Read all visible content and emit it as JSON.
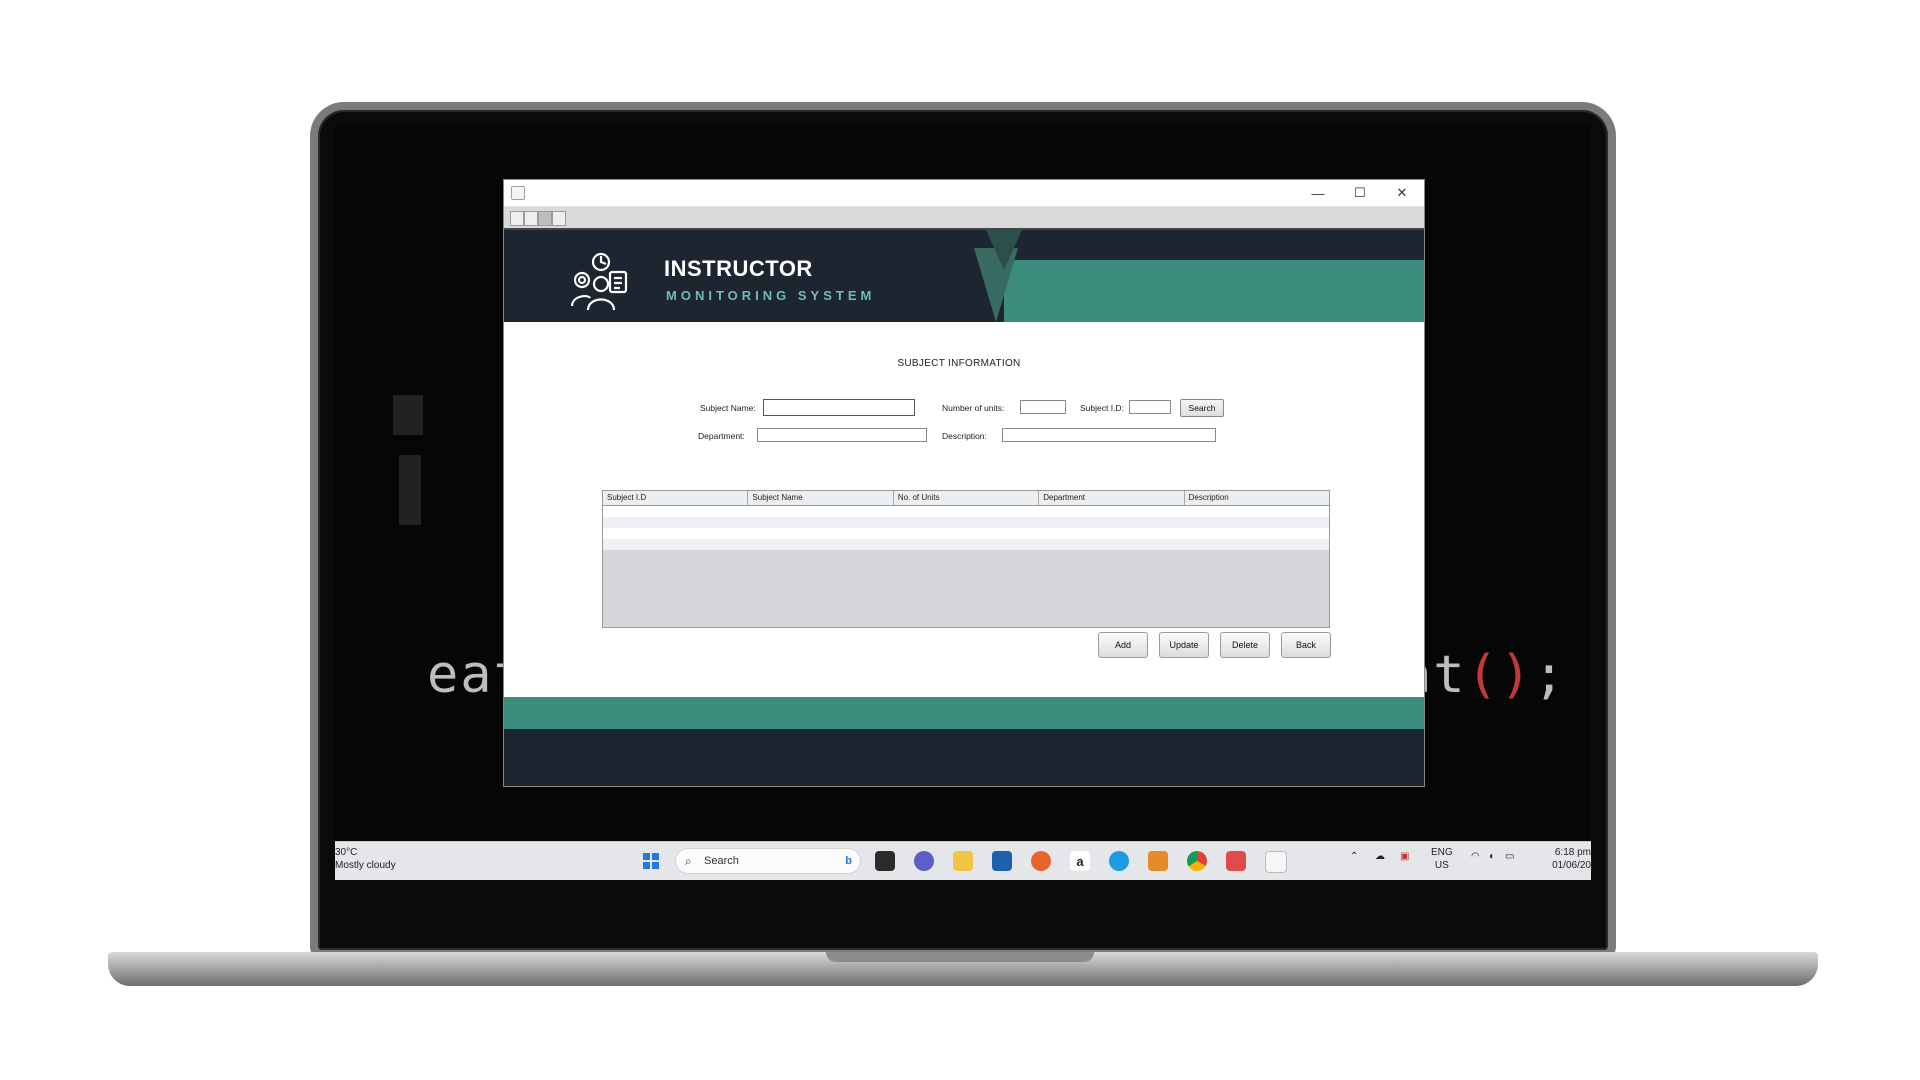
{
  "app": {
    "brand_title": "INSTRUCTOR",
    "brand_subtitle": "MONITORING SYSTEM",
    "window_controls": {
      "minimize": "—",
      "maximize": "☐",
      "close": "✕"
    }
  },
  "form": {
    "section_title": "SUBJECT INFORMATION",
    "subject_name_label": "Subject Name:",
    "subject_name_value": "",
    "units_label": "Number of units:",
    "units_value": "",
    "subject_id_label": "Subject I.D:",
    "subject_id_value": "",
    "search_button": "Search",
    "department_label": "Department:",
    "department_value": "",
    "description_label": "Description:",
    "description_value": ""
  },
  "table": {
    "columns": [
      "Subject I.D",
      "Subject Name",
      "No. of Units",
      "Department",
      "Description"
    ],
    "rows": []
  },
  "actions": {
    "add": "Add",
    "update": "Update",
    "delete": "Delete",
    "back": "Back"
  },
  "taskbar": {
    "weather_temp": "30°C",
    "weather_desc": "Mostly cloudy",
    "search_label": "Search",
    "lang_top": "ENG",
    "lang_bottom": "US",
    "time": "6:18 pm",
    "date": "01/06/20"
  },
  "wallpaper": {
    "code_left": "eat",
    "code_right": "at",
    "code_parens": "()",
    "code_semicolon": ";"
  }
}
